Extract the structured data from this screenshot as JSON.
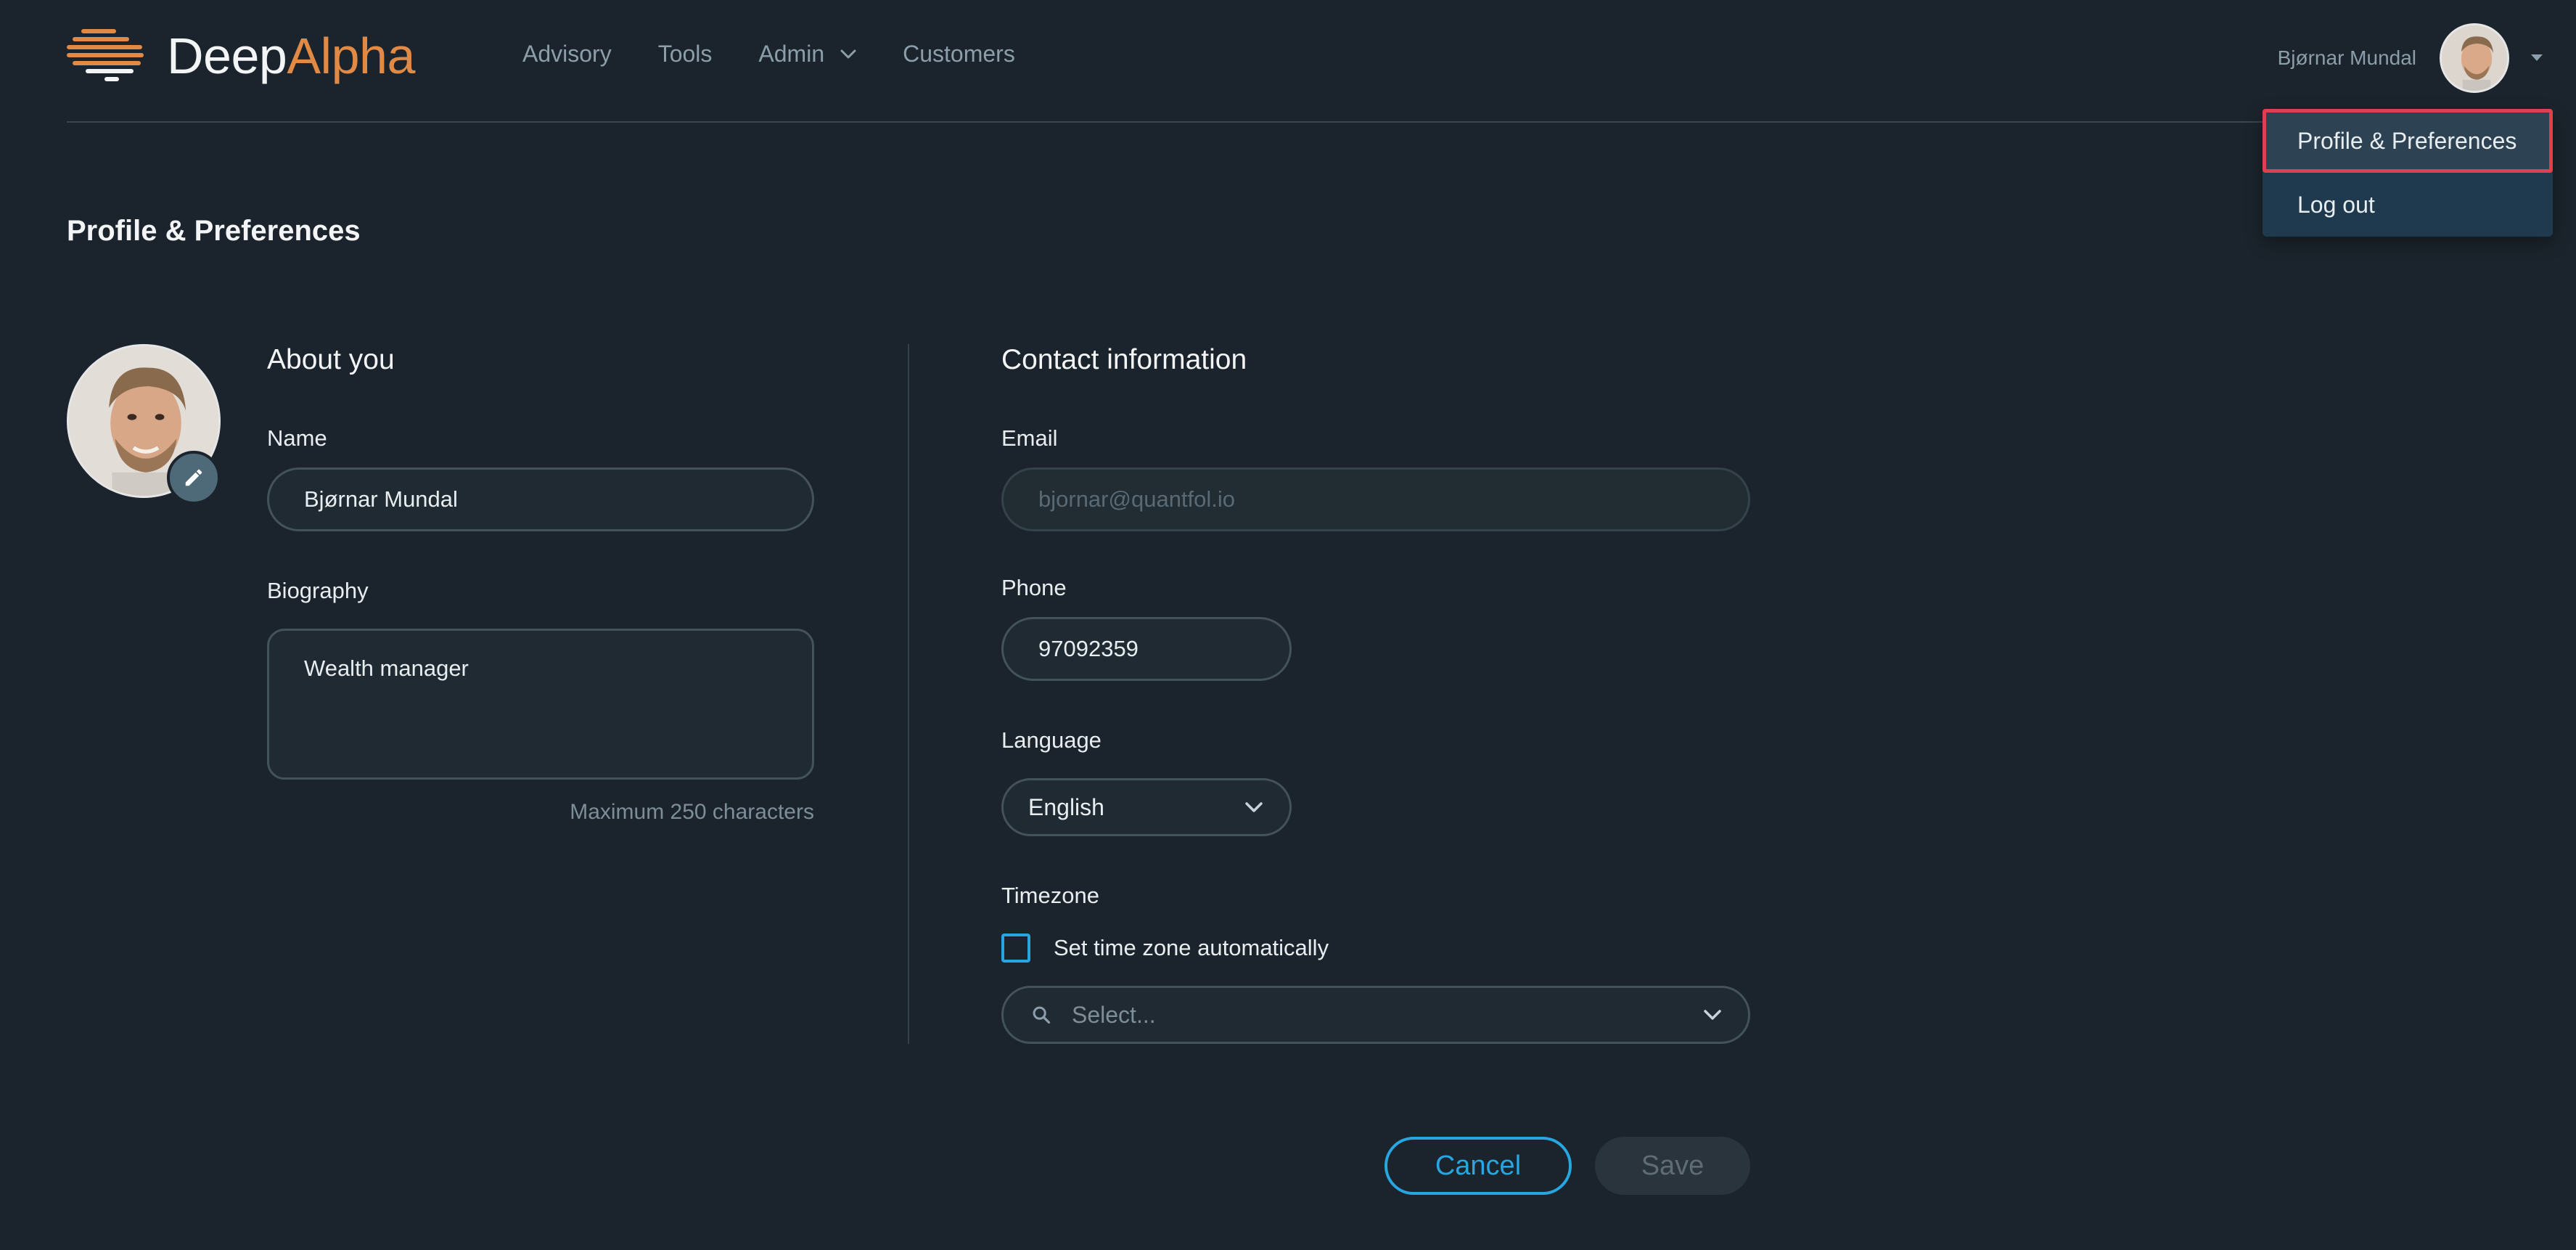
{
  "brand": {
    "name_part1": "Deep",
    "name_part2": "Alpha",
    "accent_color": "#e08a45"
  },
  "nav": {
    "items": [
      {
        "label": "Advisory"
      },
      {
        "label": "Tools"
      },
      {
        "label": "Admin",
        "has_dropdown": true
      },
      {
        "label": "Customers"
      }
    ]
  },
  "user": {
    "name": "Bjørnar Mundal",
    "avatar_icon": "user-photo"
  },
  "user_menu": {
    "items": [
      {
        "label": "Profile & Preferences",
        "active": true
      },
      {
        "label": "Log out"
      }
    ]
  },
  "page": {
    "title": "Profile & Preferences"
  },
  "about": {
    "heading": "About you",
    "name_label": "Name",
    "name_value": "Bjørnar Mundal",
    "bio_label": "Biography",
    "bio_value": "Wealth manager",
    "bio_hint": "Maximum 250 characters"
  },
  "contact": {
    "heading": "Contact information",
    "email_label": "Email",
    "email_value": "bjornar@quantfol.io",
    "phone_label": "Phone",
    "phone_value": "97092359",
    "language_label": "Language",
    "language_value": "English",
    "timezone_label": "Timezone",
    "timezone_auto_label": "Set time zone automatically",
    "timezone_auto_checked": false,
    "timezone_placeholder": "Select..."
  },
  "actions": {
    "cancel_label": "Cancel",
    "save_label": "Save",
    "accent_color": "#27a6e0"
  }
}
